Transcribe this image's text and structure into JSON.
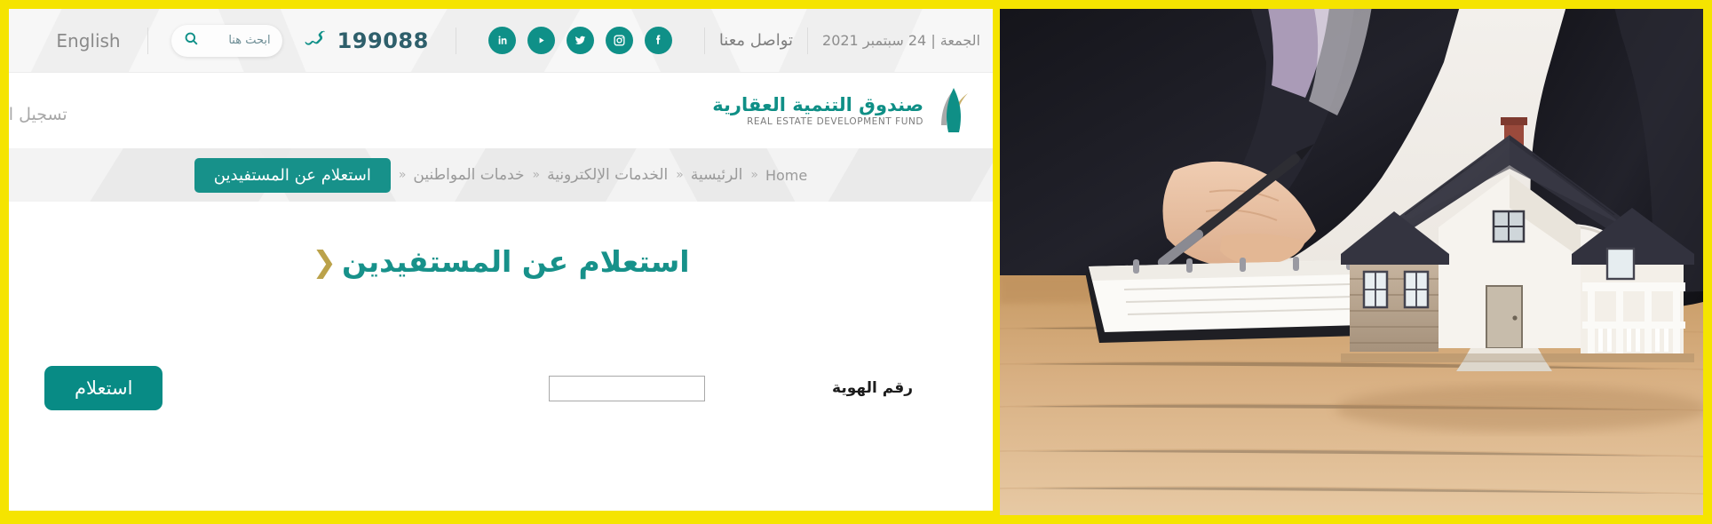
{
  "frame": {
    "border_color": "#f5e400"
  },
  "brand": {
    "teal": "#0f9088",
    "teal_dark": "#17918a",
    "gold": "#bba24a"
  },
  "topbar": {
    "date": "الجمعة | 24 سبتمبر 2021",
    "contact_label": "تواصل معنا",
    "phone": "199088",
    "phone_icon": "phone-icon",
    "social": [
      {
        "name": "facebook-icon",
        "label": "Facebook"
      },
      {
        "name": "instagram-icon",
        "label": "Instagram"
      },
      {
        "name": "twitter-icon",
        "label": "Twitter"
      },
      {
        "name": "youtube-icon",
        "label": "YouTube"
      },
      {
        "name": "linkedin-icon",
        "label": "LinkedIn"
      }
    ],
    "search": {
      "placeholder": "ابحث هنا",
      "value": "",
      "icon": "search-icon"
    },
    "language_label": "English"
  },
  "header": {
    "logo_ar": "صندوق التنمية العقارية",
    "logo_en": "REAL ESTATE DEVELOPMENT FUND",
    "login_label": "تسجيل الد"
  },
  "breadcrumb": {
    "home": "Home",
    "sep": "«",
    "items": [
      {
        "label": "الرئيسية"
      },
      {
        "label": "الخدمات الإلكترونية"
      },
      {
        "label": "خدمات المواطنين"
      }
    ],
    "current": "استعلام عن المستفيدين"
  },
  "main": {
    "title": "استعلام عن المستفيدين",
    "title_arrow": "❮",
    "form": {
      "id_label": "رقم الهوية",
      "id_value": "",
      "id_placeholder": "",
      "submit_label": "استعلام"
    }
  },
  "photo": {
    "alt": "رجل أعمال يوقّع مستندات بجوار مجسم منزل",
    "desk_color": "#cfa675",
    "suit_color": "#1b1b20",
    "house_roof": "#3a3a44",
    "house_wall": "#b9a591"
  }
}
